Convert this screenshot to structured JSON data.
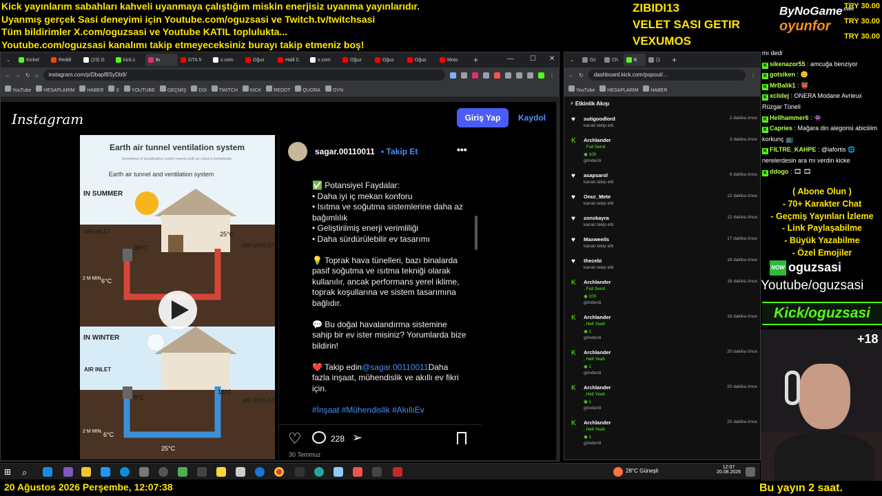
{
  "ticker": [
    "Kick yayınlarım sabahları kahveli uyanmaya çalıştığım miskin enerjisiz uyanma yayınlarıdır.",
    "Uyanmış gerçek Sasi deneyimi için Youtube.com/oguzsasi ve Twitch.tv/twitchsasi",
    "Tüm bildirimler X.com/oguzsasi ve Youtube KATIL toplulukta...",
    "Youtube.com/oguzsasi kanalımı takip etmeyeceksiniz burayı takip etmeniz boş!"
  ],
  "top_names": [
    "ZIBIDI13",
    "VELET SASI GETIR",
    "VEXUMOS"
  ],
  "logo": {
    "line1": "ByNoGame",
    "sup": ".com",
    "line2": "oyunfor"
  },
  "try_amounts": [
    "TRY 30.00",
    "TRY 30.00",
    "TRY 30.00"
  ],
  "browser_left": {
    "tabs": [
      "Kickel",
      "Reddi",
      "(23) G",
      "kick.c",
      "In",
      "GTA 5",
      "x.com",
      "Oğuz",
      "Halil C",
      "x.com",
      "Oğuz",
      "Oğuz",
      "Oğuz",
      "Moto"
    ],
    "tab_colors": [
      "#53fc18",
      "#ff4500",
      "#ffffff",
      "#53fc18",
      "#e1306c",
      "#ff0000",
      "#ffffff",
      "#ff0000",
      "#ff0000",
      "#ffffff",
      "#ff0000",
      "#ff0000",
      "#ff0000",
      "#ff0000"
    ],
    "url": "instagram.com/p/Dbapf8SyDb9/",
    "bookmarks": [
      "YouTube",
      "HESAPLARIM",
      "HABER",
      "X",
      "YOUTUBE",
      "GEÇMİŞ",
      "DSİ",
      "TWITCH",
      "KICK",
      "REDDT",
      "QUORA",
      "OYN"
    ]
  },
  "instagram": {
    "logo": "Instagram",
    "login": "Giriş Yap",
    "signup": "Kaydol",
    "username": "sagar.00110011",
    "follow": "Takip Et",
    "caption": {
      "p1": [
        "✅ Potansiyel Faydalar:",
        "• Daha iyi iç mekan konforu",
        "• Isıtma ve soğutma sistemlerine daha az bağımlılık",
        "• Geliştirilmiş enerji verimliliği",
        "• Daha sürdürülebilir ev tasarımı"
      ],
      "p2": "💡 Toprak hava tünelleri, bazı binalarda pasif soğutma ve ısıtma tekniği olarak kullanılır, ancak performans yerel iklime, toprak koşullarına ve sistem tasarımına bağlıdır.",
      "p3": "💬 Bu doğal havalandırma sistemine sahip bir ev ister misiniz? Yorumlarda bize bildirin!",
      "p4_prefix": "❤️ Takip edin",
      "p4_mention": "@sagar.00110011",
      "p4_suffix": "Daha fazla inşaat, mühendislik ve akıllı ev fikri için.",
      "tags": "#İnşaat #Mühendislik #AkıllıEv #SürdürülebilirYaşam"
    },
    "comments": "228",
    "date": "30 Temmuz",
    "media": {
      "title": "Earth air tunnel ventilation system",
      "subtitle": "Sometimes of tunnelisation system means endh an called a homatlende.",
      "label": "Earth air tunnel and ventilation system",
      "summer": "IN SUMMER",
      "winter": "IN WINTER",
      "air_inlet": "AIR INLET",
      "air_outlet": "AIR OUTLET",
      "s_in": "35°C",
      "s_room": "25°C",
      "s_ground": "6°C",
      "w_in": "6°C",
      "w_room": "16°C",
      "w_ground": "6°C",
      "w_tube": "25°C",
      "depth": "2 M MIN."
    }
  },
  "browser_right": {
    "tabs": [
      "Gc",
      "Ch",
      "K",
      "(1"
    ],
    "url": "dashboard.kick.com/popout/...",
    "bookmarks": [
      "YouTube",
      "HESAPLARIM",
      "HABER"
    ],
    "feed_title": "Etkinlik Akışı",
    "feed": [
      {
        "name": "sutigoodlord",
        "time": "2 dakika önce",
        "sub": "kanalı takip etti",
        "type": "follow"
      },
      {
        "name": "Archlander",
        "time": "3 dakika önce",
        "sub": ", Full Send",
        "amount": "100",
        "sent": "gönderdi",
        "type": "kick"
      },
      {
        "name": "asapsarol",
        "time": "6 dakika önce",
        "sub": "kanalı takip etti",
        "type": "follow"
      },
      {
        "name": "Onur_Mete",
        "time": "12 dakika önce",
        "sub": "kanalı takip etti",
        "type": "follow"
      },
      {
        "name": "zonskayra",
        "time": "12 dakika önce",
        "sub": "kanalı takip etti",
        "type": "follow"
      },
      {
        "name": "Maxweeils",
        "time": "17 dakika önce",
        "sub": "kanalı takip etti",
        "type": "follow"
      },
      {
        "name": "thecebi",
        "time": "18 dakika önce",
        "sub": "kanalı takip etti",
        "type": "follow"
      },
      {
        "name": "Archlander",
        "time": "18 dakika önce",
        "sub": ", Full Send",
        "amount": "100",
        "sent": "gönderdi",
        "type": "kick"
      },
      {
        "name": "Archlander",
        "time": "19 dakika önce",
        "sub": ", Hell Yeah",
        "amount": "1",
        "sent": "gönderdi",
        "type": "kick"
      },
      {
        "name": "Archlander",
        "time": "20 dakika önce",
        "sub": ", Hell Yeah",
        "amount": "1",
        "sent": "gönderdi",
        "type": "kick"
      },
      {
        "name": "Archlander",
        "time": "20 dakika önce",
        "sub": ", Hell Yeah",
        "amount": "1",
        "sent": "gönderdi",
        "type": "kick"
      },
      {
        "name": "Archlander",
        "time": "20 dakika önce",
        "sub": ", Hell Yeah",
        "amount": "1",
        "sent": "gönderdi",
        "type": "kick"
      }
    ]
  },
  "chat": [
    {
      "user": "",
      "text": "mı dedi"
    },
    {
      "user": "sikenazor55",
      "text": "amcuğa benziyor"
    },
    {
      "user": "gotsiken",
      "text": "🙂"
    },
    {
      "user": "MrBalik1",
      "text": "👹"
    },
    {
      "user": "xclidej",
      "text": "ONERA Modane Avrieux Rüzgar Tüneli"
    },
    {
      "user": "Hellhammer6",
      "text": "👾"
    },
    {
      "user": "Capries",
      "text": "Mağara din alegorisi abiciiiim korkunç 📺"
    },
    {
      "user": "FILTRE_KAHPE",
      "text": "@lafortis 🌐 nerelerdesin ara mı verdin kicke"
    },
    {
      "user": "ddogo",
      "text": "🎞 🎞"
    }
  ],
  "promo": [
    "( Abone Olun )",
    "- 70+ Karakter Chat",
    "- Geçmiş Yayınları İzleme",
    "- Link Paylaşabilme",
    "- Büyük Yazabilme",
    "- Özel Emojiler"
  ],
  "now_name": "oguzsasi",
  "now_badge": "NOW",
  "yt": "Youtube/oguzsasi",
  "kick_handle": "Kick/oguzsasi",
  "viewers": "+18",
  "taskbar": {
    "weather": "28°C Güneşli",
    "time": "12:07",
    "date": "20.08.2026"
  },
  "bottom_left": "20 Ağustos 2026 Perşembe, 12:07:38",
  "bottom_right": "Bu yayın 2 saat."
}
